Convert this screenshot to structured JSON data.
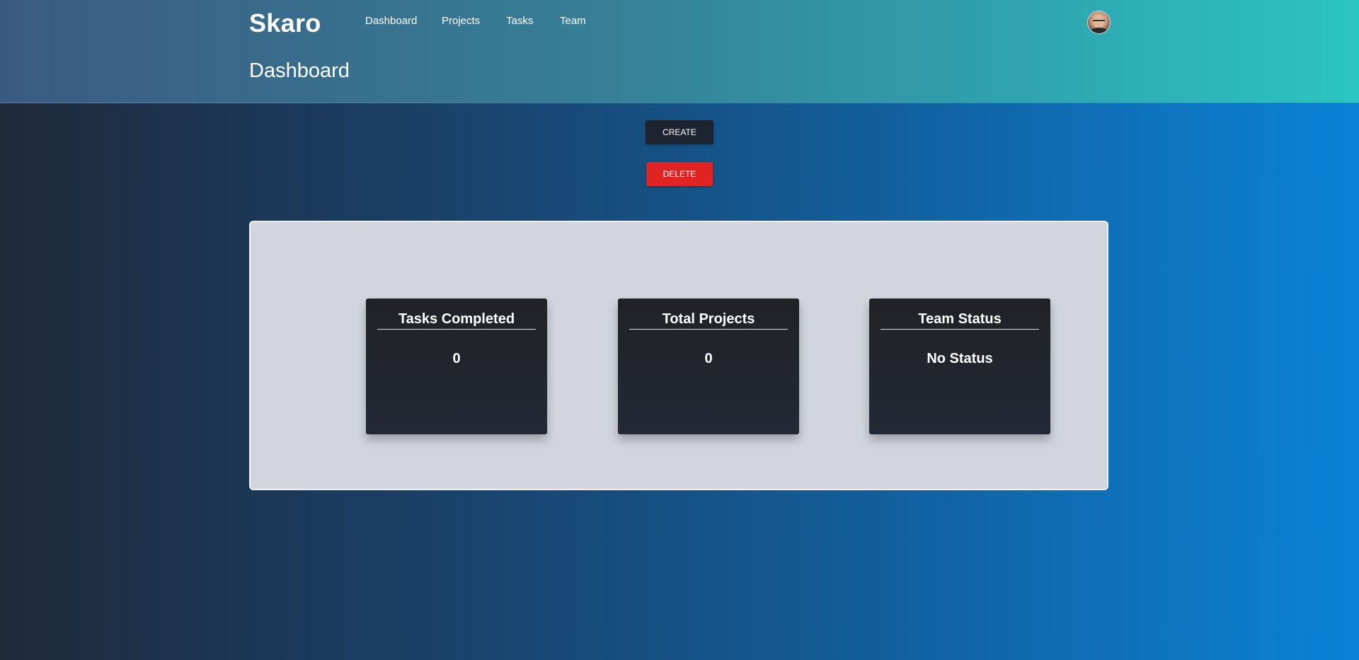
{
  "brand": "Skaro",
  "nav": {
    "items": [
      {
        "label": "Dashboard"
      },
      {
        "label": "Projects"
      },
      {
        "label": "Tasks"
      },
      {
        "label": "Team"
      }
    ]
  },
  "page": {
    "title": "Dashboard"
  },
  "actions": {
    "create_label": "CREATE",
    "delete_label": "DELETE"
  },
  "stats": [
    {
      "title": "Tasks Completed",
      "value": "0"
    },
    {
      "title": "Total Projects",
      "value": "0"
    },
    {
      "title": "Team Status",
      "value": "No Status"
    }
  ],
  "colors": {
    "create_button": "#1e2330",
    "delete_button": "#e02424",
    "card_background": "#212226",
    "panel_background": "#d2d5de"
  },
  "icons": {
    "avatar": "user-avatar-icon"
  }
}
